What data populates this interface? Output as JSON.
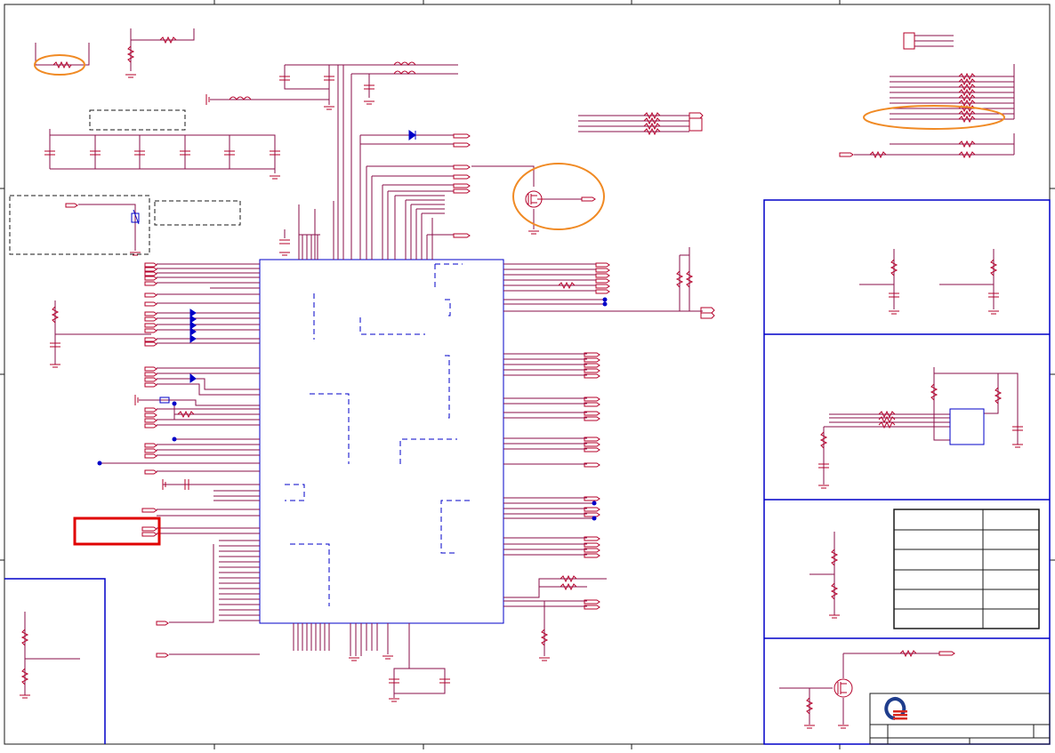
{
  "colors": {
    "wire": "#8a0f4a",
    "component": "#b4002a",
    "bus": "#0000c8",
    "frame": "#1a1a1a",
    "highlight_ellipse": "#f08a24",
    "highlight_box": "#e00000",
    "logo_blue": "#1f3d8c",
    "logo_red": "#d8281e"
  },
  "highlights": {
    "ellipses": [
      "resistor-top-left",
      "resistor-array-top-right",
      "mosfet-top-center"
    ],
    "boxes": [
      "connector-left-middle"
    ]
  },
  "title_block": {
    "logo": "quanta-logo-icon"
  },
  "icons": [
    "resistor-icon",
    "capacitor-icon",
    "inductor-icon",
    "diode-icon",
    "mosfet-icon",
    "ground-icon",
    "connector-arrow-icon",
    "junction-dot-icon"
  ]
}
